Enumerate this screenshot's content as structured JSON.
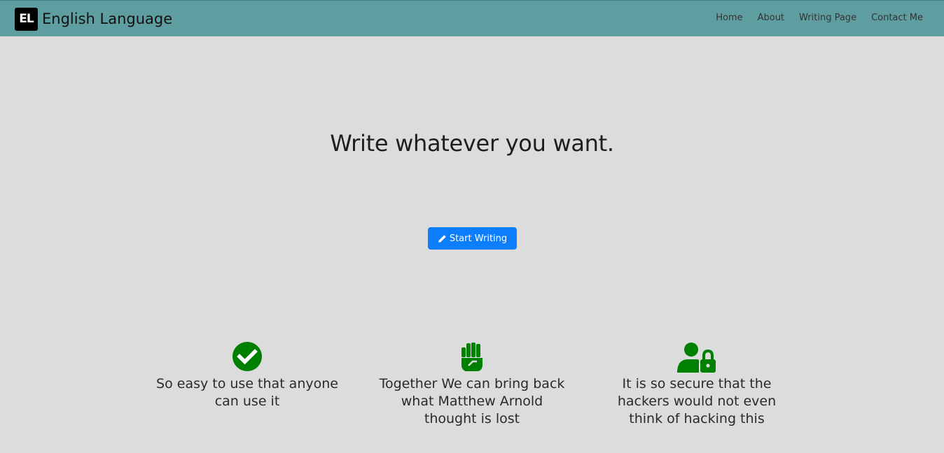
{
  "brand": {
    "logo_text": "EL",
    "name": "English Language"
  },
  "nav": {
    "items": [
      "Home",
      "About",
      "Writing Page",
      "Contact Me"
    ]
  },
  "hero": {
    "headline": "Write whatever you want.",
    "cta_label": "Start Writing",
    "cta_icon": "pencil-icon",
    "cta_color": "#0d7efb"
  },
  "features": [
    {
      "icon": "check-circle-icon",
      "text": "So easy to use that anyone can use it"
    },
    {
      "icon": "fist-icon",
      "text": "Together We can bring back what Matthew Arnold thought is lost"
    },
    {
      "icon": "user-lock-icon",
      "text": "It is so secure that the hackers would not even think of hacking this"
    }
  ],
  "colors": {
    "navbar": "#5f9ea0",
    "background": "#dcdcdc",
    "icon_green": "#008000"
  }
}
